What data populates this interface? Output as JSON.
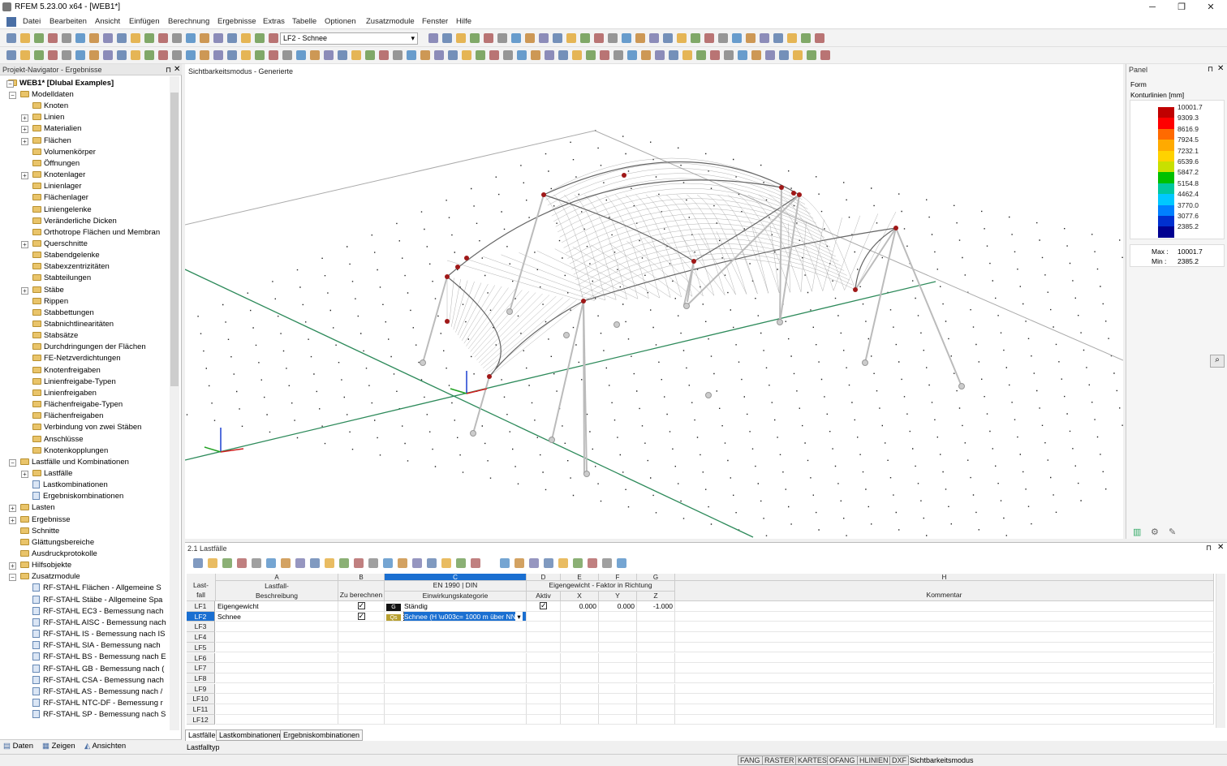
{
  "app": {
    "title": "RFEM 5.23.00 x64 - [WEB1*]"
  },
  "menu": [
    "Datei",
    "Bearbeiten",
    "Ansicht",
    "Einfügen",
    "Berechnung",
    "Ergebnisse",
    "Extras",
    "Tabelle",
    "Optionen",
    "Zusatzmodule",
    "Fenster",
    "Hilfe"
  ],
  "toolbar": {
    "loadcase": "LF2 - Schnee"
  },
  "navigator": {
    "title": "Projekt-Navigator - Ergebnisse",
    "root": "WEB1* [Dlubal Examples]",
    "items": [
      "Modelldaten",
      "Knoten",
      "Linien",
      "Materialien",
      "Flächen",
      "Volumenkörper",
      "Öffnungen",
      "Knotenlager",
      "Linienlager",
      "Flächenlager",
      "Liniengelenke",
      "Veränderliche Dicken",
      "Orthotrope Flächen und Membran",
      "Querschnitte",
      "Stabendgelenke",
      "Stabexzentrizitäten",
      "Stabteilungen",
      "Stäbe",
      "Rippen",
      "Stabbettungen",
      "Stabnichtlinearitäten",
      "Stabsätze",
      "Durchdringungen der Flächen",
      "FE-Netzverdichtungen",
      "Knotenfreigaben",
      "Linienfreigabe-Typen",
      "Linienfreigaben",
      "Flächenfreigabe-Typen",
      "Flächenfreigaben",
      "Verbindung von zwei Stäben",
      "Anschlüsse",
      "Knotenkopplungen",
      "Lastfälle und Kombinationen",
      "Lastfälle",
      "Lastkombinationen",
      "Ergebniskombinationen",
      "Lasten",
      "Ergebnisse",
      "Schnitte",
      "Glättungsbereiche",
      "Ausdruckprotokolle",
      "Hilfsobjekte",
      "Zusatzmodule",
      "RF-STAHL Flächen - Allgemeine S",
      "RF-STAHL Stäbe - Allgemeine Spa",
      "RF-STAHL EC3 - Bemessung nach",
      "RF-STAHL AISC - Bemessung nach",
      "RF-STAHL IS - Bemessung nach IS",
      "RF-STAHL SIA - Bemessung nach",
      "RF-STAHL BS - Bemessung nach E",
      "RF-STAHL GB - Bemessung nach (",
      "RF-STAHL CSA - Bemessung nach",
      "RF-STAHL AS - Bemessung nach /",
      "RF-STAHL NTC-DF - Bemessung r",
      "RF-STAHL SP - Bemessung nach S"
    ],
    "tabs": [
      "Daten",
      "Zeigen",
      "Ansichten"
    ]
  },
  "view": {
    "mode": "Sichtbarkeitsmodus - Generierte"
  },
  "panel": {
    "title": "Panel",
    "form": "Form",
    "subtitle": "Konturlinien [mm]",
    "legend": [
      "10001.7",
      "9309.3",
      "8616.9",
      "7924.5",
      "7232.1",
      "6539.6",
      "5847.2",
      "5154.8",
      "4462.4",
      "3770.0",
      "3077.6",
      "2385.2"
    ],
    "colors": [
      "#c00000",
      "#ff0000",
      "#ff6a00",
      "#ffaa00",
      "#ffd200",
      "#c8e000",
      "#00c000",
      "#00c8a0",
      "#00c8ff",
      "#0080ff",
      "#0030d0",
      "#000090"
    ],
    "max_label": "Max :",
    "max": "10001.7",
    "min_label": "Min :",
    "min": "2385.2"
  },
  "table": {
    "title": "2.1 Lastfälle",
    "cols": {
      "a": "A",
      "b": "B",
      "c": "C",
      "d": "D",
      "e": "E",
      "f": "F",
      "g": "G",
      "h": "H"
    },
    "hdr": {
      "lastfall": "Last-\nfall",
      "a": "Lastfall-\nBeschreibung",
      "b": "Zu berechnen",
      "c1": "EN 1990 | DIN",
      "c2": "Einwirkungskategorie",
      "d1": "Eigengewicht  -  Faktor in Richtung",
      "d2": "Aktiv",
      "e": "X",
      "f": "Y",
      "g": "Z",
      "h": "Kommentar"
    },
    "rows": [
      {
        "id": "LF1",
        "desc": "Eigengewicht",
        "code": "G",
        "cat": "Ständig",
        "x": "0.000",
        "y": "0.000",
        "z": "-1.000"
      },
      {
        "id": "LF2",
        "desc": "Schnee",
        "code": "Qs",
        "cat": "Schnee (H \\u003c= 1000 m über NN)",
        "x": "",
        "y": "",
        "z": ""
      },
      {
        "id": "LF3"
      },
      {
        "id": "LF4"
      },
      {
        "id": "LF5"
      },
      {
        "id": "LF6"
      },
      {
        "id": "LF7"
      },
      {
        "id": "LF8"
      },
      {
        "id": "LF9"
      },
      {
        "id": "LF10"
      },
      {
        "id": "LF11"
      },
      {
        "id": "LF12"
      }
    ],
    "tabs": [
      "Lastfälle",
      "Lastkombinationen",
      "Ergebniskombinationen"
    ],
    "status": "Lastfalltyp"
  },
  "statusbar": [
    "FANG",
    "RASTER",
    "KARTES",
    "OFANG",
    "HLINIEN",
    "DXF"
  ],
  "statusbar_text": "Sichtbarkeitsmodus"
}
